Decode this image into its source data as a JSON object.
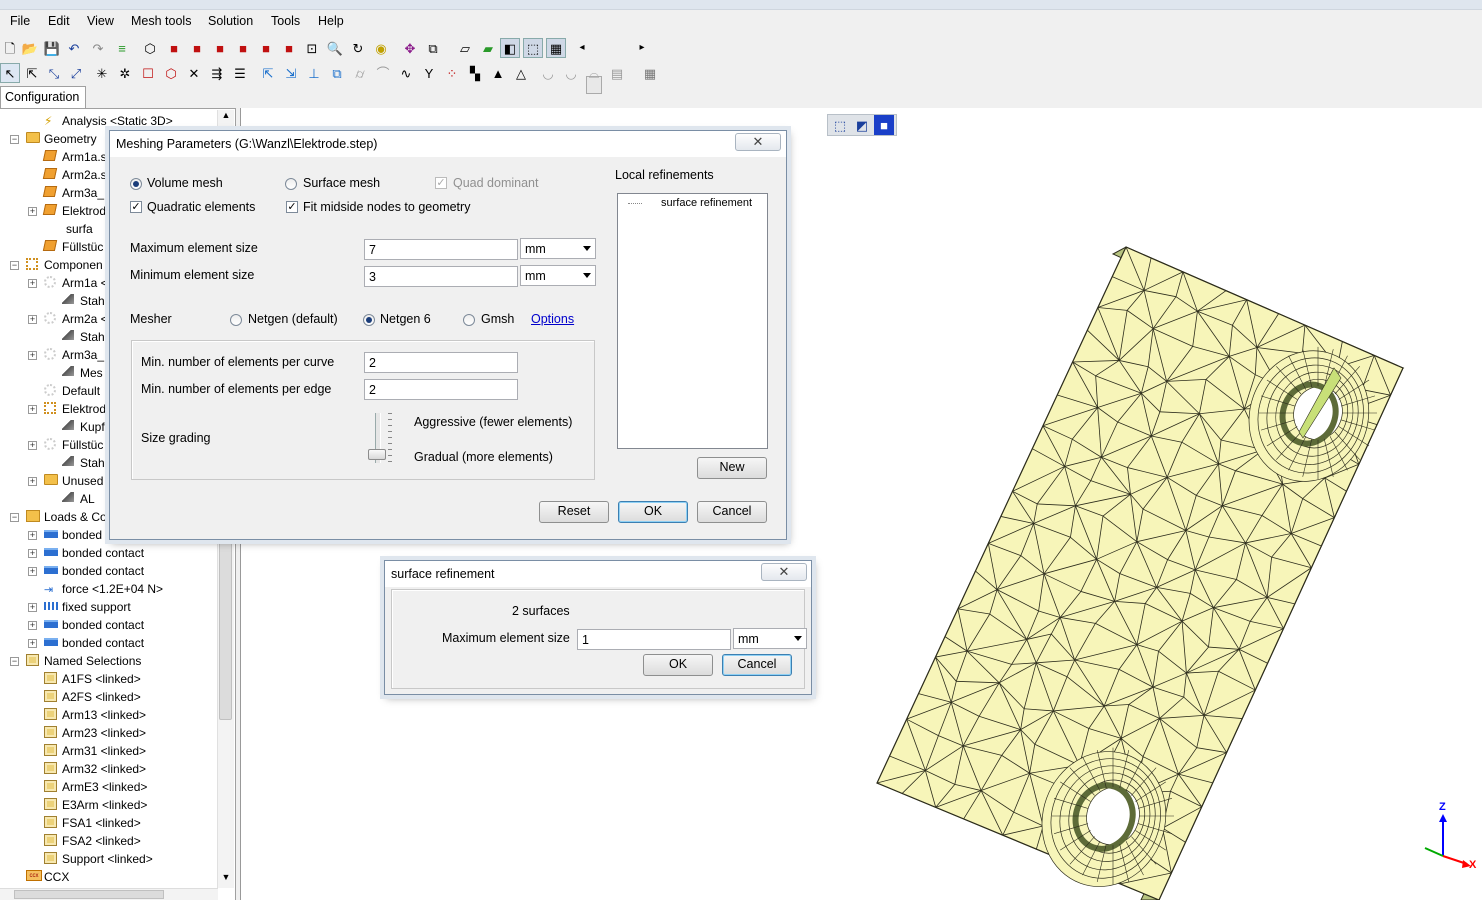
{
  "menubar": {
    "items": [
      "File",
      "Edit",
      "View",
      "Mesh tools",
      "Solution",
      "Tools",
      "Help"
    ]
  },
  "tab": {
    "label": "Configuration"
  },
  "tree": {
    "rows": [
      {
        "label": "Analysis <Static 3D>"
      },
      {
        "label": "Geometry"
      },
      {
        "label": "Arm1a.s"
      },
      {
        "label": "Arm2a.s"
      },
      {
        "label": "Arm3a_"
      },
      {
        "label": "Elektrod"
      },
      {
        "label": "surfa"
      },
      {
        "label": "Füllstüc"
      },
      {
        "label": "Componen"
      },
      {
        "label": "Arm1a <"
      },
      {
        "label": "Stah"
      },
      {
        "label": "Arm2a <"
      },
      {
        "label": "Stah"
      },
      {
        "label": "Arm3a_"
      },
      {
        "label": "Mes"
      },
      {
        "label": "Default"
      },
      {
        "label": "Elektrod"
      },
      {
        "label": "Kupf"
      },
      {
        "label": "Füllstüc"
      },
      {
        "label": "Stah"
      },
      {
        "label": "Unused"
      },
      {
        "label": "AL"
      },
      {
        "label": "Loads & Co"
      },
      {
        "label": "bonded"
      },
      {
        "label": "bonded contact"
      },
      {
        "label": "bonded contact"
      },
      {
        "label": "force <1.2E+04 N>"
      },
      {
        "label": "fixed support"
      },
      {
        "label": "bonded contact"
      },
      {
        "label": "bonded contact"
      },
      {
        "label": "Named Selections"
      },
      {
        "label": "A1FS <linked>"
      },
      {
        "label": "A2FS <linked>"
      },
      {
        "label": "Arm13 <linked>"
      },
      {
        "label": "Arm23 <linked>"
      },
      {
        "label": "Arm31 <linked>"
      },
      {
        "label": "Arm32 <linked>"
      },
      {
        "label": "ArmE3 <linked>"
      },
      {
        "label": "E3Arm <linked>"
      },
      {
        "label": "FSA1 <linked>"
      },
      {
        "label": "FSA2 <linked>"
      },
      {
        "label": "Support <linked>"
      },
      {
        "label": "CCX"
      }
    ]
  },
  "meshing": {
    "title": "Meshing Parameters (G:\\Wanzl\\Elektrode.step)",
    "close": "✕",
    "volume_mesh": "Volume mesh",
    "surface_mesh": "Surface mesh",
    "quad_dominant": "Quad dominant",
    "quadratic": "Quadratic elements",
    "fit_midside": "Fit midside nodes to geometry",
    "max_size_label": "Maximum element size",
    "max_size_value": "7",
    "max_unit": "mm",
    "min_size_label": "Minimum element size",
    "min_size_value": "3",
    "min_unit": "mm",
    "mesher_label": "Mesher",
    "netgen_default": "Netgen (default)",
    "netgen6": "Netgen 6",
    "gmsh": "Gmsh",
    "options_link": "Options",
    "per_curve_label": "Min. number of elements per curve",
    "per_curve_value": "2",
    "per_edge_label": "Min. number of elements per edge",
    "per_edge_value": "2",
    "size_grading": "Size grading",
    "aggressive": "Aggressive (fewer elements)",
    "gradual": "Gradual (more elements)",
    "grading_level": 0.0,
    "local_ref_label": "Local refinements",
    "local_ref_item": "surface refinement",
    "new_btn": "New",
    "reset_btn": "Reset",
    "ok_btn": "OK",
    "cancel_btn": "Cancel"
  },
  "surface_ref": {
    "title": "surface refinement",
    "close": "✕",
    "count": "2 surfaces",
    "max_size_label": "Maximum element size",
    "max_size_value": "1",
    "unit": "mm",
    "ok_btn": "OK",
    "cancel_btn": "Cancel"
  },
  "axes": {
    "z": "Z",
    "x": "X"
  },
  "colors": {
    "mesh_fill": "#f7f5b9",
    "mesh_edge": "#2d2d1c",
    "side": "#b6c37f"
  }
}
